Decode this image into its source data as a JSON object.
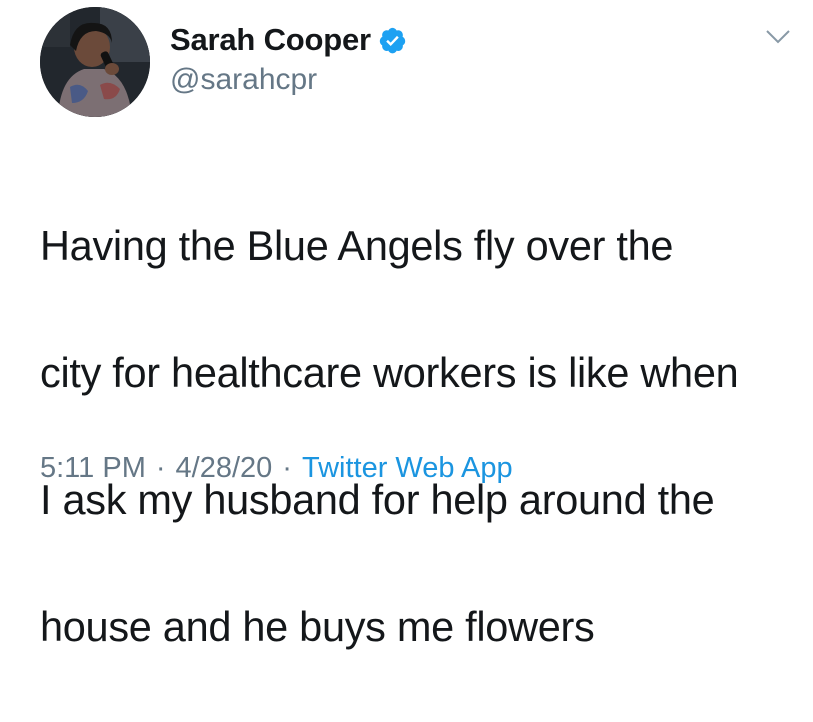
{
  "user": {
    "display_name": "Sarah Cooper",
    "handle": "@sarahcpr",
    "verified_icon": "verified-badge-icon",
    "avatar_icon": "profile-photo"
  },
  "tweet": {
    "line1": "Having the Blue Angels fly over the",
    "line2": "city for healthcare workers is like when",
    "line3": "I ask my husband for help around the",
    "line4": "house and he buys me flowers"
  },
  "meta": {
    "time": "5:11 PM",
    "separator": "·",
    "date": "4/28/20",
    "source": "Twitter Web App"
  },
  "colors": {
    "text": "#14171a",
    "secondary": "#657786",
    "link": "#1b95e0",
    "verified": "#1da1f2"
  }
}
